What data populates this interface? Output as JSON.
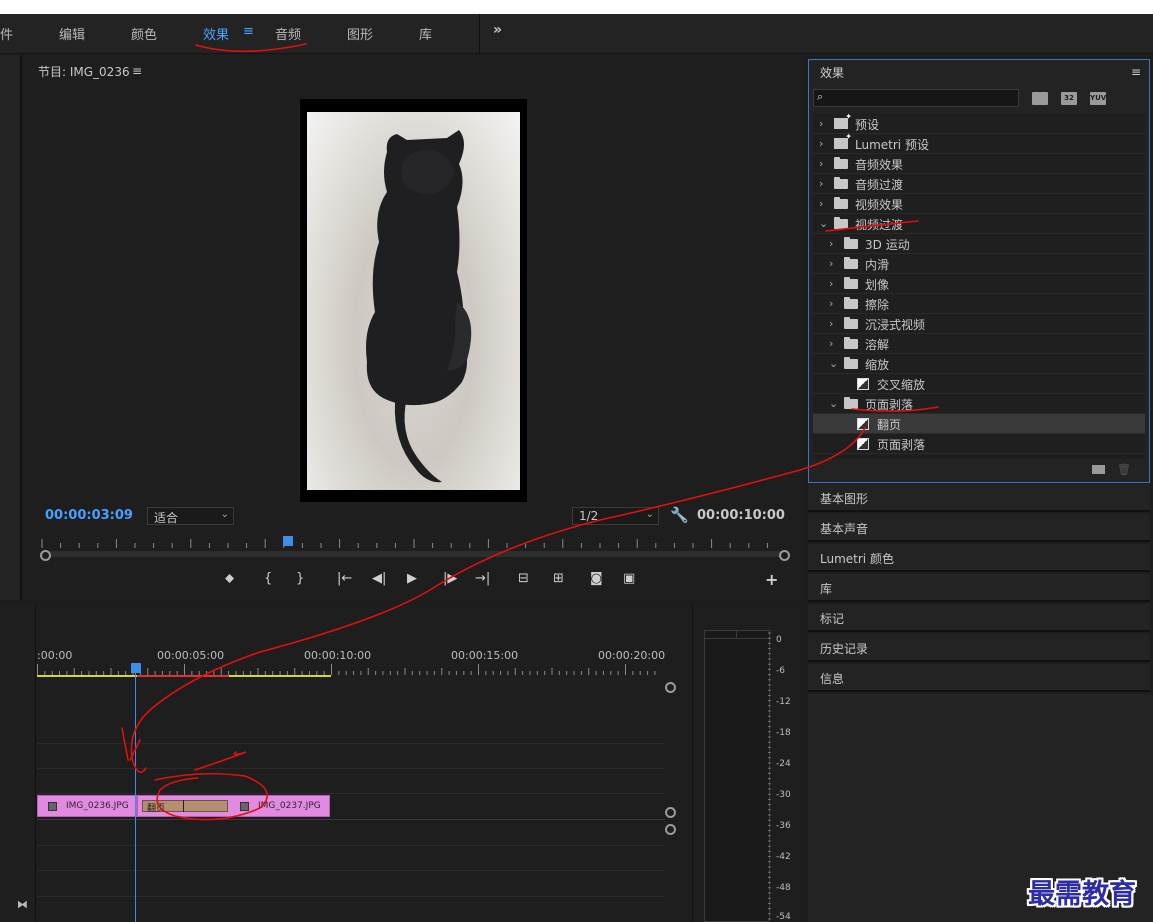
{
  "workspace": {
    "tabs": [
      {
        "label": "件"
      },
      {
        "label": "编辑"
      },
      {
        "label": "颜色"
      },
      {
        "label": "效果",
        "active": true
      },
      {
        "label": "音频"
      },
      {
        "label": "图形"
      },
      {
        "label": "库"
      }
    ],
    "active_menu_glyph": "≡",
    "more_glyph": "»"
  },
  "monitor": {
    "title": "节目: IMG_0236",
    "menu_glyph": "≡",
    "timecode_current": "00:00:03:09",
    "fit_select": "适合",
    "resolution_select": "1/2",
    "timecode_total": "00:00:10:00"
  },
  "transport": {
    "icons": [
      "marker-icon",
      "mark-in-icon",
      "mark-out-icon",
      "go-to-in-icon",
      "step-back-icon",
      "play-icon",
      "step-forward-icon",
      "go-to-out-icon",
      "lift-icon",
      "extract-icon",
      "export-frame-icon",
      "compare-icon",
      "add-button-icon"
    ],
    "glyphs": [
      "⬥",
      "{",
      "}",
      "|←",
      "◀|",
      "▶",
      "|▶",
      "→|",
      "⊟",
      "⊞",
      "◙",
      "▣",
      "+"
    ]
  },
  "timeline": {
    "time_labels": [
      ":00:00",
      "00:00:05:00",
      "00:00:10:00",
      "00:00:15:00",
      "00:00:20:00"
    ],
    "clips": [
      {
        "name": "IMG_0236.JPG"
      },
      {
        "name": "IMG_0237.JPG"
      }
    ],
    "transition_label": "翻页"
  },
  "meter": {
    "db_labels": [
      "0",
      "-6",
      "-12",
      "-18",
      "-24",
      "-30",
      "-36",
      "-42",
      "-48",
      "-54"
    ]
  },
  "effects_panel": {
    "title": "效果",
    "menu_glyph": "≡",
    "search_icon": "⌕",
    "badges": [
      "32",
      "YUV"
    ],
    "tree": [
      {
        "label": "预设",
        "kind": "preset",
        "depth": 0,
        "expanded": false
      },
      {
        "label": "Lumetri 预设",
        "kind": "preset",
        "depth": 0,
        "expanded": false
      },
      {
        "label": "音频效果",
        "kind": "folder",
        "depth": 0,
        "expanded": false
      },
      {
        "label": "音频过渡",
        "kind": "folder",
        "depth": 0,
        "expanded": false
      },
      {
        "label": "视频效果",
        "kind": "folder",
        "depth": 0,
        "expanded": false
      },
      {
        "label": "视频过渡",
        "kind": "folder",
        "depth": 0,
        "expanded": true
      },
      {
        "label": "3D 运动",
        "kind": "folder",
        "depth": 1,
        "expanded": false
      },
      {
        "label": "内滑",
        "kind": "folder",
        "depth": 1,
        "expanded": false
      },
      {
        "label": "划像",
        "kind": "folder",
        "depth": 1,
        "expanded": false
      },
      {
        "label": "擦除",
        "kind": "folder",
        "depth": 1,
        "expanded": false
      },
      {
        "label": "沉浸式视频",
        "kind": "folder",
        "depth": 1,
        "expanded": false
      },
      {
        "label": "溶解",
        "kind": "folder",
        "depth": 1,
        "expanded": false
      },
      {
        "label": "缩放",
        "kind": "folder",
        "depth": 1,
        "expanded": true
      },
      {
        "label": "交叉缩放",
        "kind": "transition",
        "depth": 2
      },
      {
        "label": "页面剥落",
        "kind": "folder",
        "depth": 1,
        "expanded": true
      },
      {
        "label": "翻页",
        "kind": "transition",
        "depth": 2,
        "selected": true
      },
      {
        "label": "页面剥落",
        "kind": "transition",
        "depth": 2
      }
    ]
  },
  "right_panels": [
    "基本图形",
    "基本声音",
    "Lumetri 颜色",
    "库",
    "标记",
    "历史记录",
    "信息"
  ],
  "watermark": "最需教育",
  "colors": {
    "accent": "#4a9eff",
    "clip": "#e28adf",
    "transition": "#b48e70",
    "annotation": "#e01010",
    "panel_focus_border": "#3c78c2"
  }
}
